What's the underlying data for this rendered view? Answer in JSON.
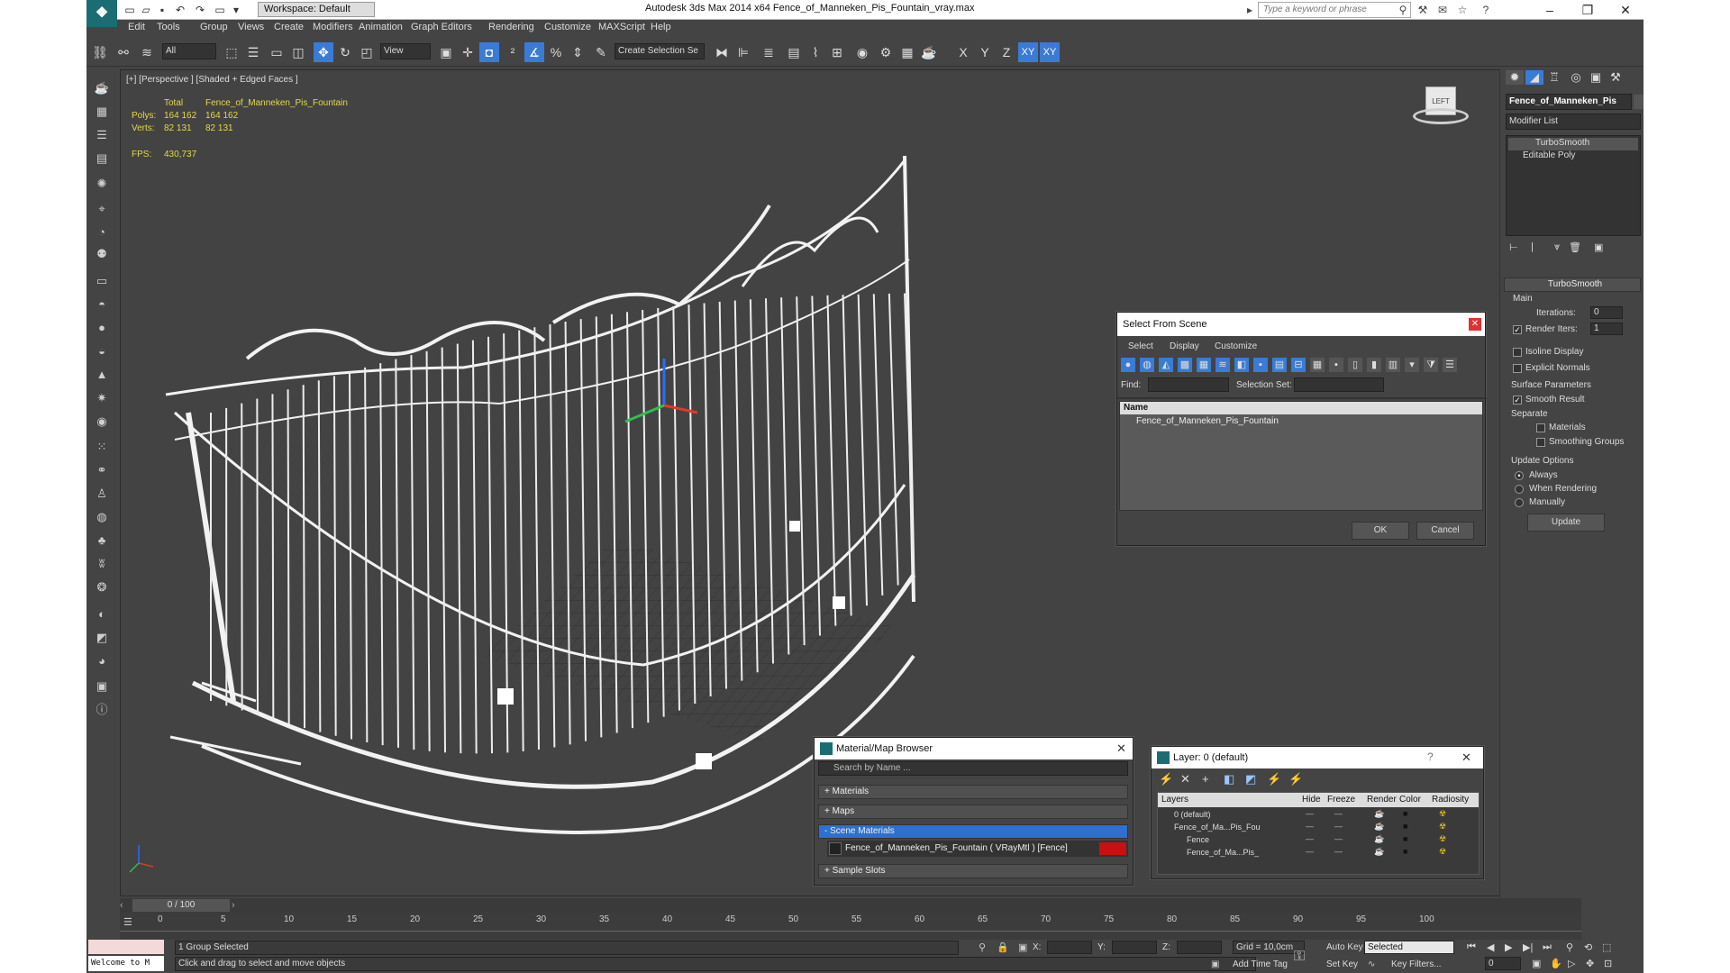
{
  "app": {
    "workspace": "Workspace: Default",
    "title": "Autodesk 3ds Max  2014 x64      Fence_of_Manneken_Pis_Fountain_vray.max",
    "search_placeholder": "Type a keyword or phrase"
  },
  "menu": [
    "Edit",
    "Tools",
    "Group",
    "Views",
    "Create",
    "Modifiers",
    "Animation",
    "Graph Editors",
    "Rendering",
    "Customize",
    "MAXScript",
    "Help"
  ],
  "toolbar": {
    "filter_value": "All",
    "ref_coord": "View",
    "selection_set": "Create Selection Se",
    "axes": [
      "X",
      "Y",
      "Z",
      "XY",
      "XY"
    ]
  },
  "viewport": {
    "label": "[+] [Perspective ] [Shaded + Edged Faces ]",
    "stats": {
      "total_label": "Total",
      "object_label": "Fence_of_Manneken_Pis_Fountain",
      "polys_label": "Polys:",
      "polys_total": "164 162",
      "polys_obj": "164 162",
      "verts_label": "Verts:",
      "verts_total": "82 131",
      "verts_obj": "82 131",
      "fps_label": "FPS:",
      "fps_value": "430,737"
    },
    "viewcube_label": "LEFT"
  },
  "command_panel": {
    "object_name": "Fence_of_Manneken_Pis",
    "modifier_list": "Modifier List",
    "stack": [
      "TurboSmooth",
      "Editable Poly"
    ],
    "rollout_title": "TurboSmooth",
    "main_label": "Main",
    "iterations_label": "Iterations:",
    "iterations_value": "0",
    "render_iters_label": "Render Iters:",
    "render_iters_value": "1",
    "isoline": "Isoline Display",
    "explicit_normals": "Explicit Normals",
    "surface_params": "Surface Parameters",
    "smooth_result": "Smooth Result",
    "separate": "Separate",
    "materials": "Materials",
    "smoothing_groups": "Smoothing Groups",
    "update_options": "Update Options",
    "always": "Always",
    "when_rendering": "When Rendering",
    "manually": "Manually",
    "update_btn": "Update"
  },
  "select_dialog": {
    "title": "Select From Scene",
    "menu": [
      "Select",
      "Display",
      "Customize"
    ],
    "find_label": "Find:",
    "selection_set_label": "Selection Set:",
    "col_name": "Name",
    "items": [
      "Fence_of_Manneken_Pis_Fountain"
    ],
    "ok": "OK",
    "cancel": "Cancel"
  },
  "material_browser": {
    "title": "Material/Map Browser",
    "search_placeholder": "Search by Name ...",
    "groups": [
      "+ Materials",
      "+ Maps",
      "- Scene Materials"
    ],
    "scene_material": "Fence_of_Manneken_Pis_Fountain  ( VRayMtl ) [Fence]",
    "sample_slots": "+ Sample Slots"
  },
  "layer_dialog": {
    "title": "Layer: 0 (default)",
    "columns": [
      "Layers",
      "Hide",
      "Freeze",
      "Render",
      "Color",
      "Radiosity"
    ],
    "rows": [
      "0 (default)",
      "Fence_of_Ma...Pis_Fou",
      "Fence",
      "Fence_of_Ma...Pis_"
    ]
  },
  "timeline": {
    "frame": "0 / 100",
    "ticks": [
      "0",
      "5",
      "10",
      "15",
      "20",
      "25",
      "30",
      "35",
      "40",
      "45",
      "50",
      "55",
      "60",
      "65",
      "70",
      "75",
      "80",
      "85",
      "90",
      "95",
      "100"
    ]
  },
  "status": {
    "maxscript": "Welcome to M",
    "selected": "1 Group Selected",
    "prompt": "Click and drag to select and move objects",
    "x_label": "X:",
    "y_label": "Y:",
    "z_label": "Z:",
    "grid": "Grid = 10,0cm",
    "add_time_tag": "Add Time Tag",
    "auto_key": "Auto Key",
    "set_key": "Set Key",
    "key_mode": "Selected",
    "key_filters": "Key Filters...",
    "frame_value": "0"
  }
}
